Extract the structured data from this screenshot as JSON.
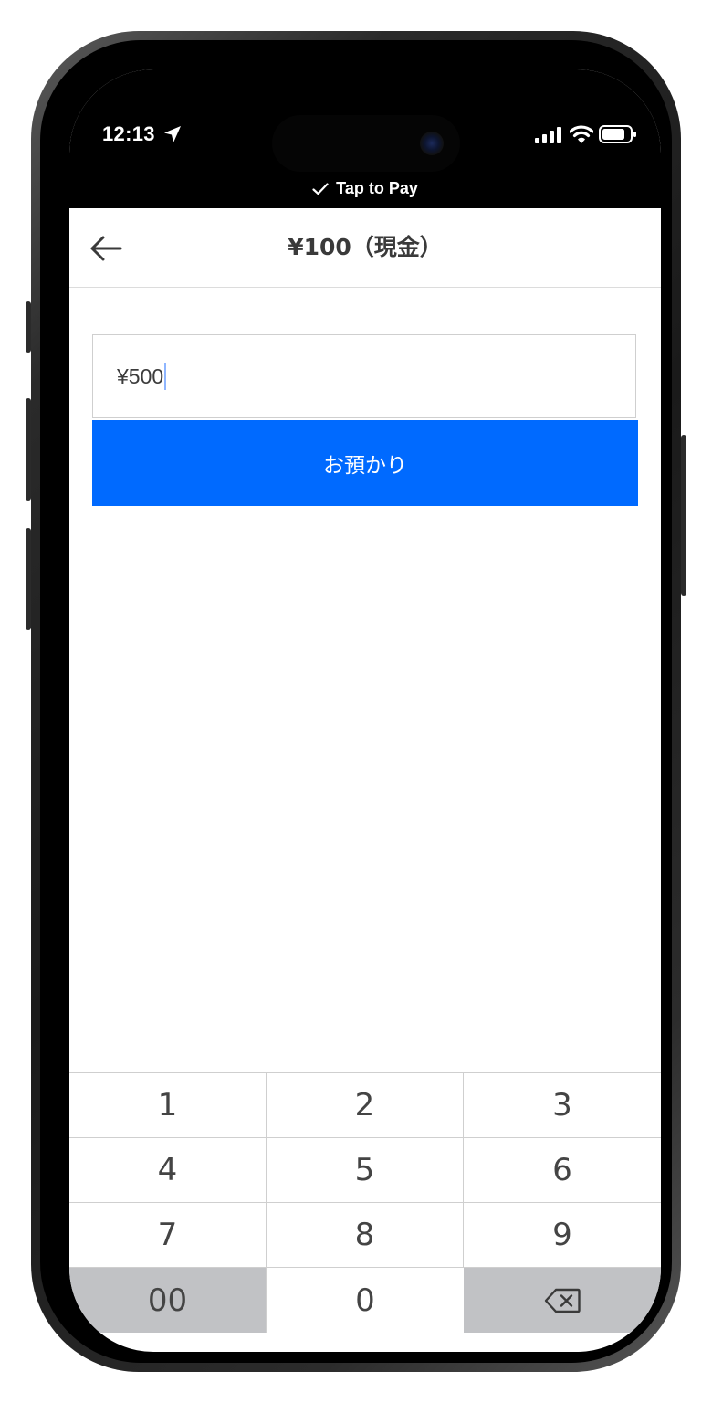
{
  "status_bar": {
    "time": "12:13",
    "banner_text": "Tap to Pay"
  },
  "header": {
    "title": "¥100（現金）"
  },
  "amount_input": {
    "value": "¥500"
  },
  "deposit_button": {
    "label": "お預かり"
  },
  "keypad": {
    "keys": [
      "1",
      "2",
      "3",
      "4",
      "5",
      "6",
      "7",
      "8",
      "9",
      "00",
      "0"
    ]
  },
  "colors": {
    "accent": "#006aff",
    "function_key_bg": "#c1c2c5"
  }
}
